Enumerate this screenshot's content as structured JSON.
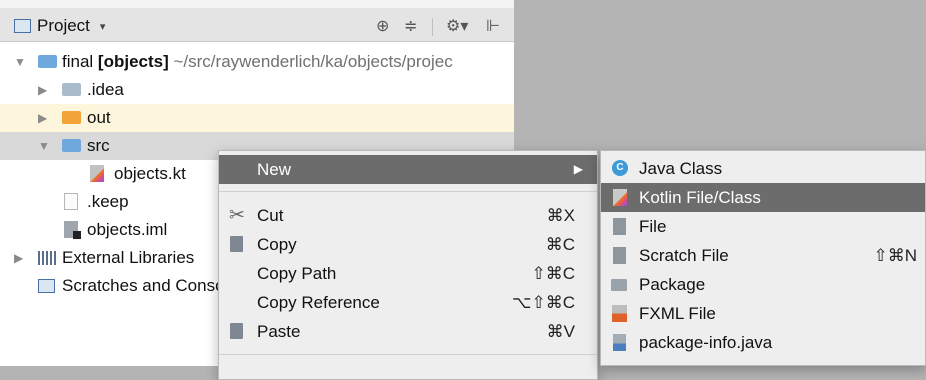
{
  "panel": {
    "title": "Project",
    "dropdown_caret": "▾",
    "tools": [
      "⊕",
      "≑",
      "⚙▾",
      "⊩"
    ]
  },
  "tree": {
    "root": {
      "name": "final",
      "module": "[objects]",
      "path": "~/src/raywenderlich/ka/objects/projec"
    },
    "idea": ".idea",
    "out": "out",
    "src": "src",
    "objects_kt": "objects.kt",
    "keep": ".keep",
    "iml": "objects.iml",
    "external_libraries": "External Libraries",
    "scratches": "Scratches and Consoles"
  },
  "context_menu": {
    "new": {
      "label": "New",
      "arrow": "▶"
    },
    "items": [
      {
        "label": "Cut",
        "shortcut": "⌘X"
      },
      {
        "label": "Copy",
        "shortcut": "⌘C"
      },
      {
        "label": "Copy Path",
        "shortcut": "⇧⌘C"
      },
      {
        "label": "Copy Reference",
        "shortcut": "⌥⇧⌘C"
      },
      {
        "label": "Paste",
        "shortcut": "⌘V"
      }
    ]
  },
  "new_submenu": {
    "items": [
      {
        "label": "Java Class",
        "shortcut": "",
        "icon": "java-class-icon"
      },
      {
        "label": "Kotlin File/Class",
        "shortcut": "",
        "icon": "kotlin-file-icon",
        "selected": true
      },
      {
        "label": "File",
        "shortcut": "",
        "icon": "file-icon"
      },
      {
        "label": "Scratch File",
        "shortcut": "⇧⌘N",
        "icon": "scratch-file-icon"
      },
      {
        "label": "Package",
        "shortcut": "",
        "icon": "package-icon"
      },
      {
        "label": "FXML File",
        "shortcut": "",
        "icon": "fxml-file-icon"
      },
      {
        "label": "package-info.java",
        "shortcut": "",
        "icon": "package-info-icon"
      }
    ]
  },
  "colors": {
    "selection": "#6c6c6c",
    "menu_bg": "#eeeeee",
    "out_folder": "#f2a33a",
    "src_folder": "#6fa8dc",
    "java_class": "#3d9ad6"
  }
}
